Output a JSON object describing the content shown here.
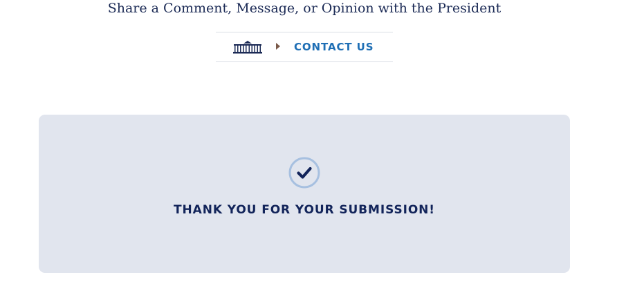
{
  "page": {
    "heading": "Share a Comment, Message, or Opinion with the President"
  },
  "breadcrumb": {
    "home_icon": "white-house-icon",
    "separator_icon": "caret-right-icon",
    "current_label": "CONTACT US"
  },
  "confirmation": {
    "icon": "check-circle-icon",
    "message": "THANK YOU FOR YOUR SUBMISSION!"
  },
  "colors": {
    "heading": "#1b2a55",
    "link": "#1f6fb5",
    "panel_bg": "#e1e5ee",
    "navy": "#12245a",
    "circle_ring": "#a7c0e0"
  }
}
